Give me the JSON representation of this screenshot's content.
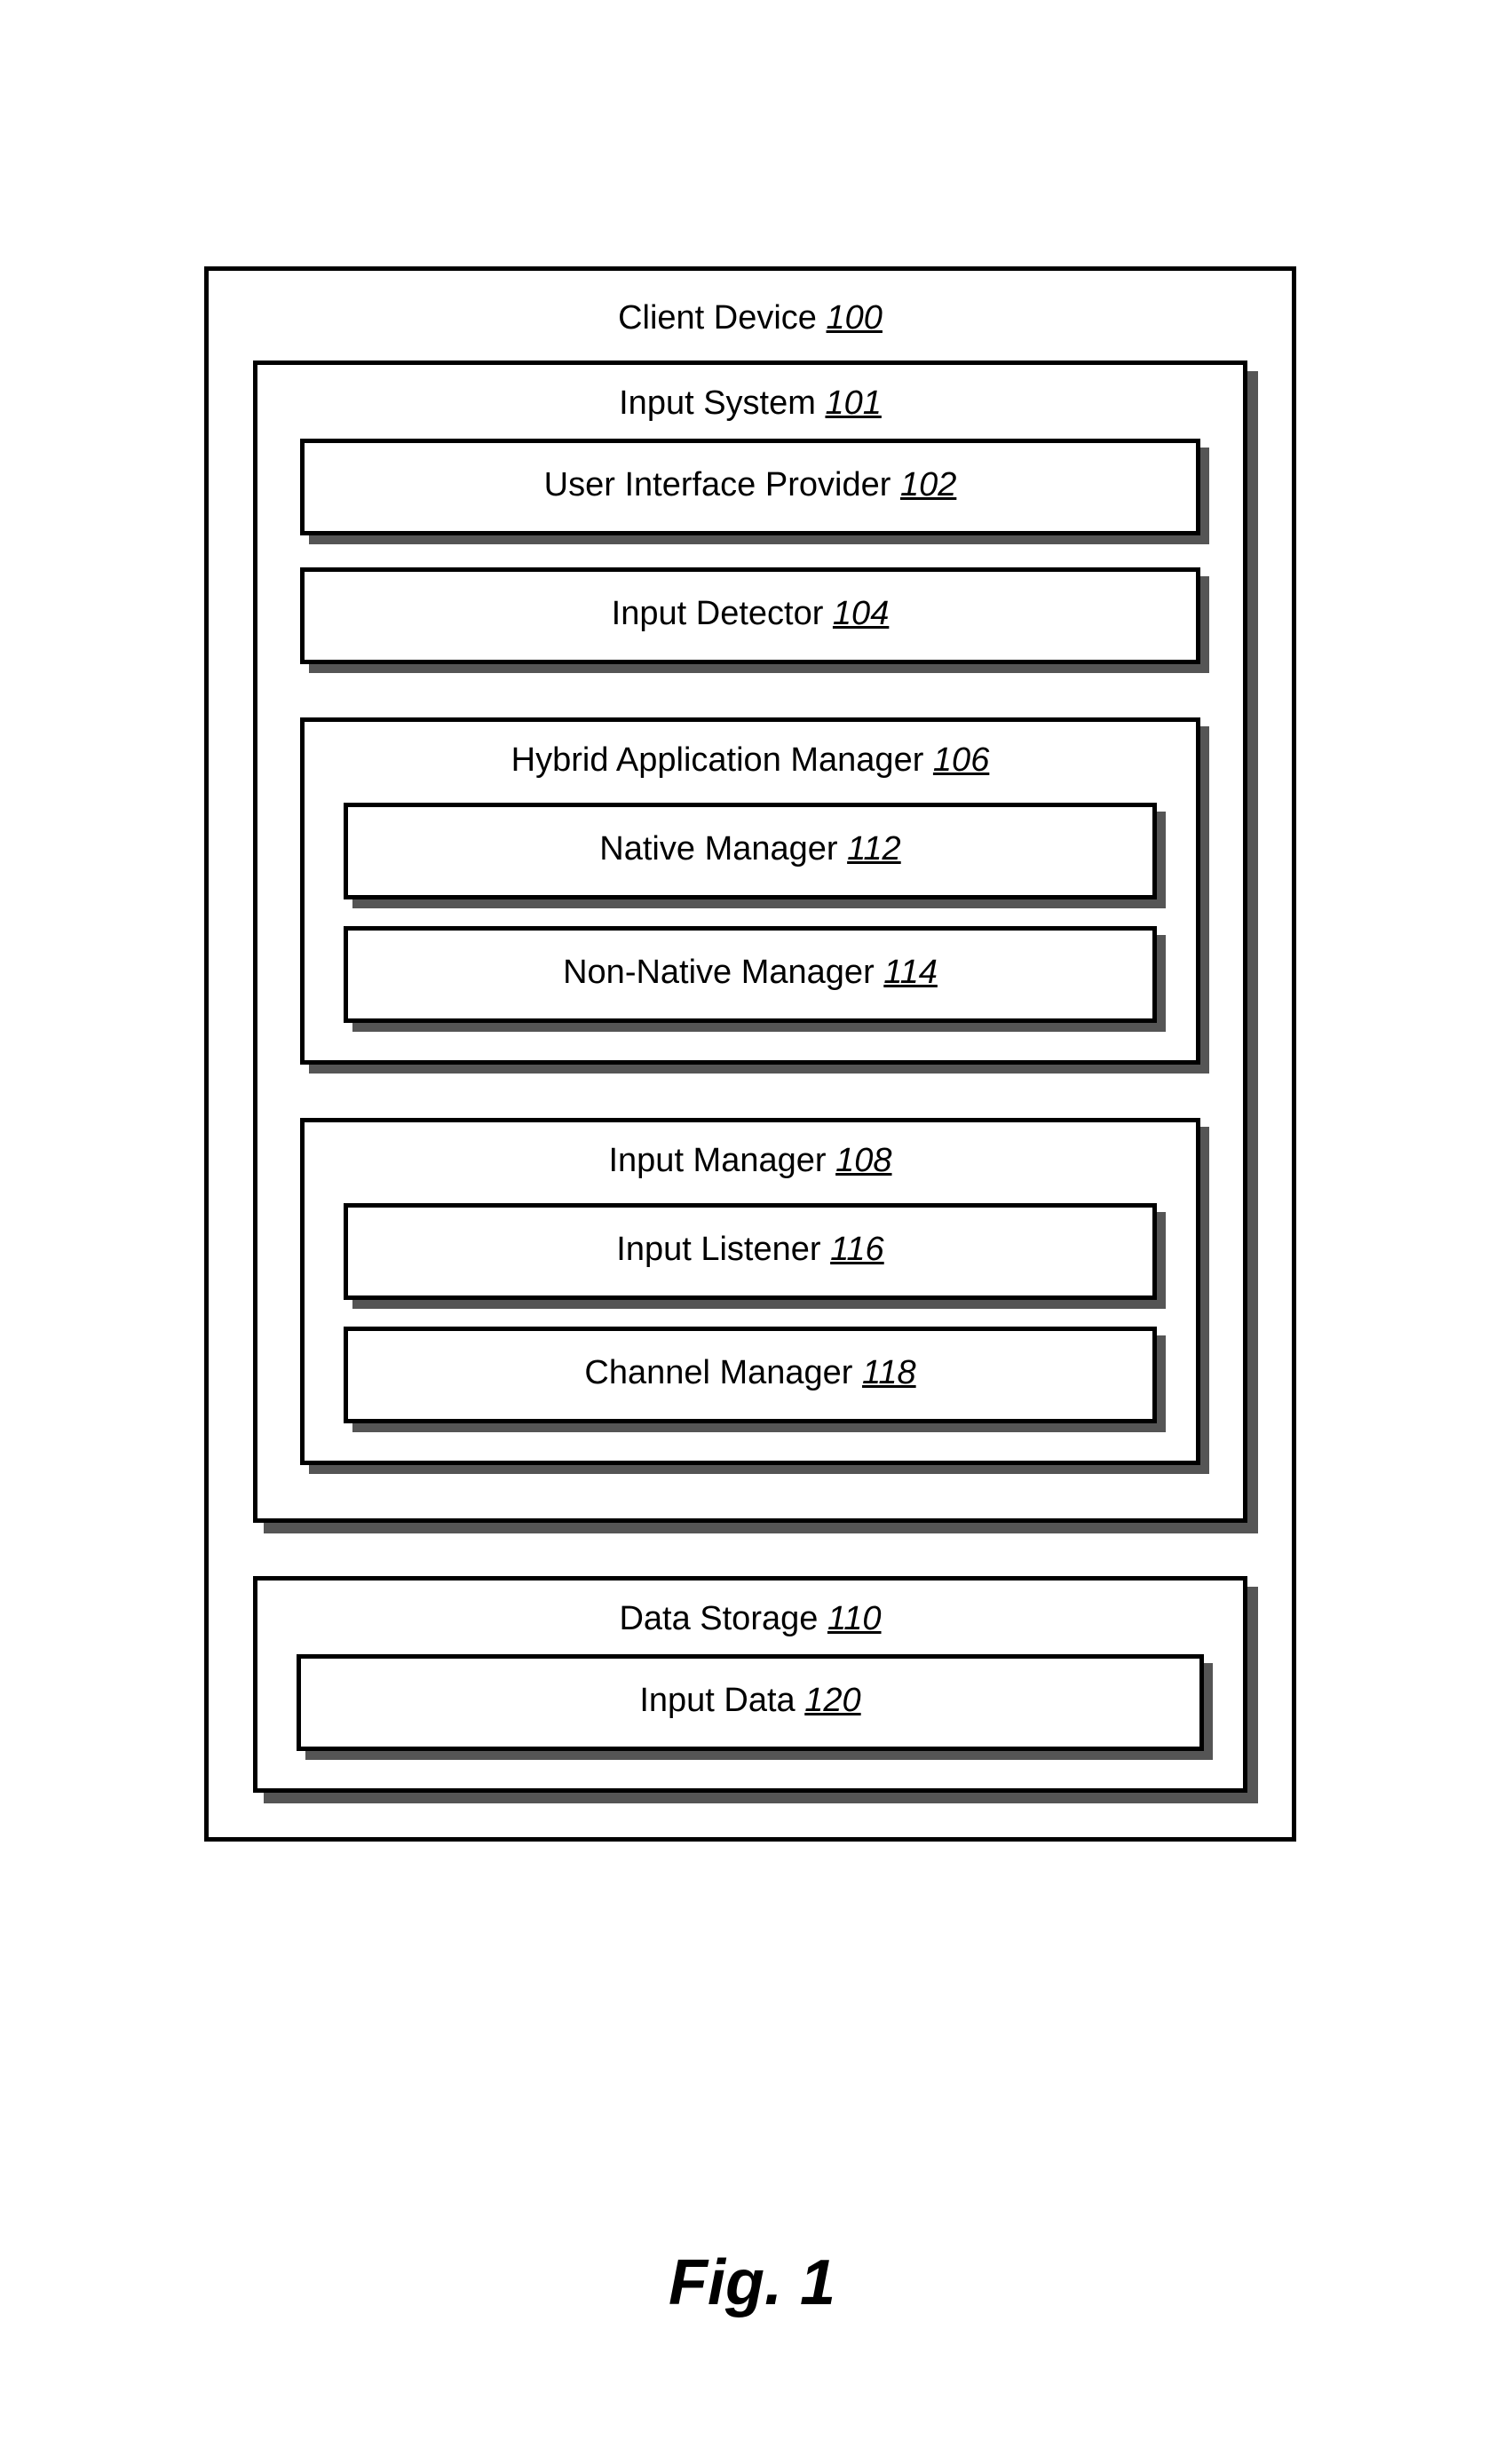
{
  "diagram": {
    "outer": {
      "label": "Client Device",
      "ref": "100"
    },
    "input_system": {
      "label": "Input System",
      "ref": "101"
    },
    "ui_provider": {
      "label": "User Interface Provider",
      "ref": "102"
    },
    "input_detector": {
      "label": "Input Detector",
      "ref": "104"
    },
    "hybrid_app_mgr": {
      "label": "Hybrid Application Manager",
      "ref": "106"
    },
    "native_mgr": {
      "label": "Native Manager",
      "ref": "112"
    },
    "non_native_mgr": {
      "label": "Non-Native Manager",
      "ref": "114"
    },
    "input_mgr": {
      "label": "Input Manager",
      "ref": "108"
    },
    "input_listener": {
      "label": "Input Listener",
      "ref": "116"
    },
    "channel_mgr": {
      "label": "Channel Manager",
      "ref": "118"
    },
    "data_storage": {
      "label": "Data Storage",
      "ref": "110"
    },
    "input_data": {
      "label": "Input Data",
      "ref": "120"
    }
  },
  "caption": "Fig. 1"
}
